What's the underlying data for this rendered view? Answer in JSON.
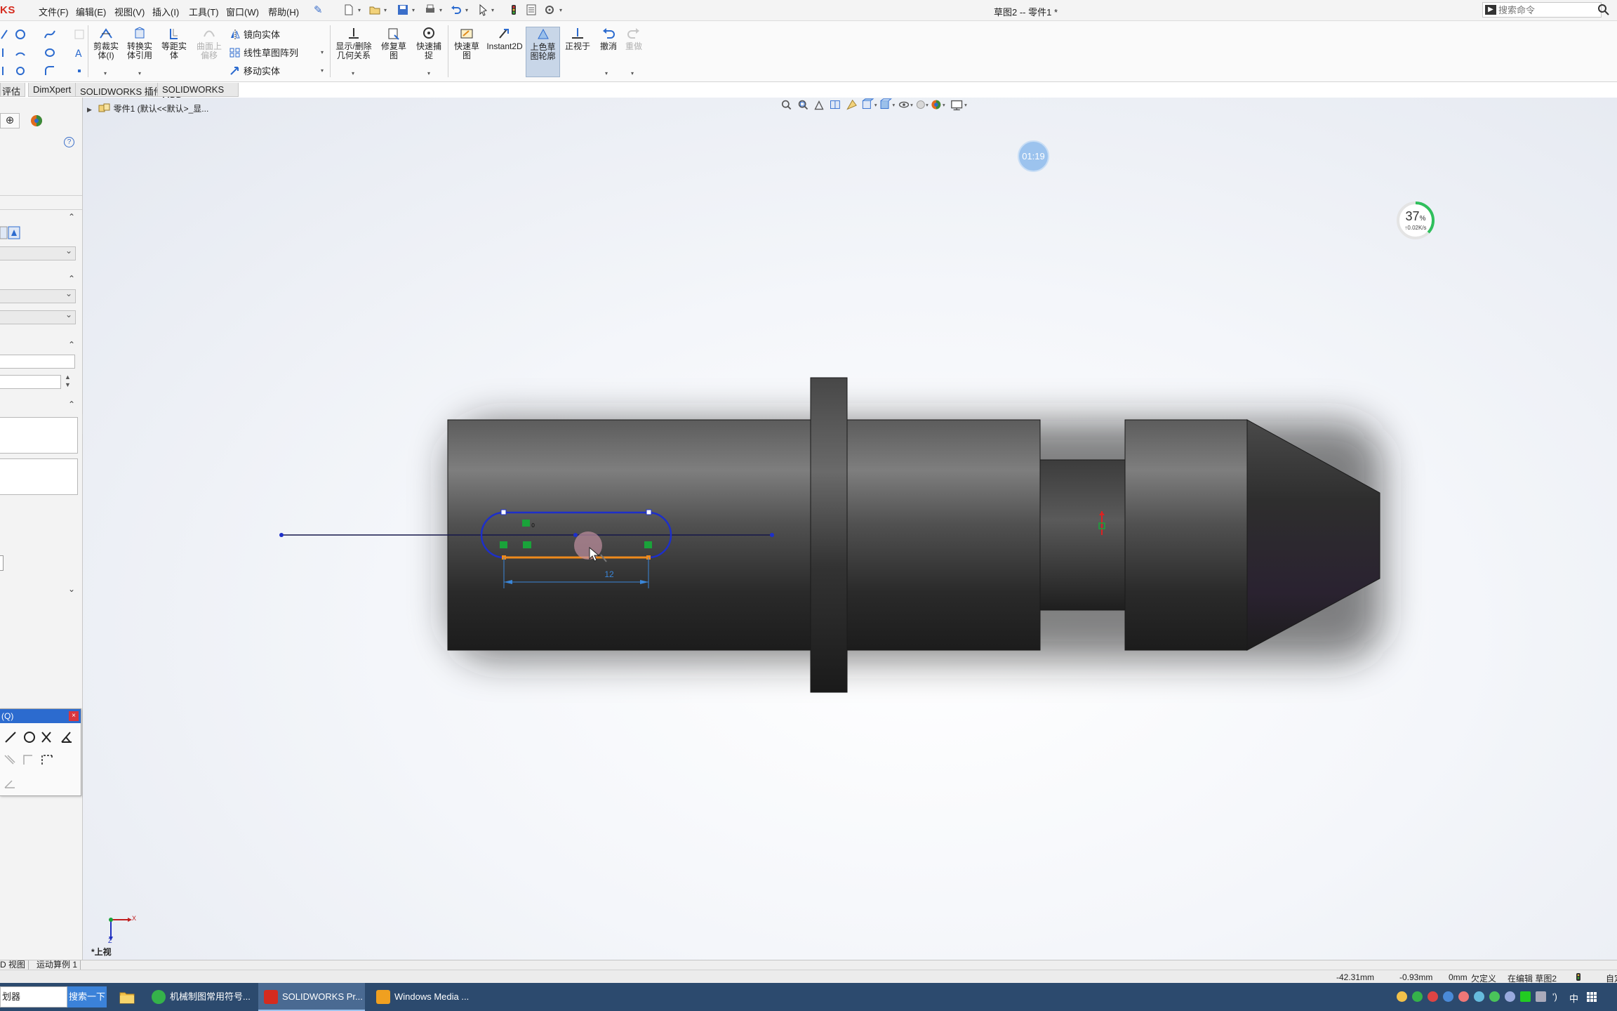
{
  "app": {
    "logo_text": "KS",
    "window_title": "草图2 -- 零件1 *"
  },
  "menu": {
    "items": [
      "文件(F)",
      "编辑(E)",
      "视图(V)",
      "插入(I)",
      "工具(T)",
      "窗口(W)",
      "帮助(H)"
    ]
  },
  "search": {
    "placeholder": "搜索命令"
  },
  "ribbon": {
    "trim": "剪裁实\n体(I)",
    "convert": "转换实\n体引用",
    "offset": "等距实\n体",
    "surface_offset": "曲面上\n偏移",
    "mirror": "镜向实体",
    "linear_pattern": "线性草图阵列",
    "move": "移动实体",
    "relations": "显示/删除\n几何关系",
    "repair": "修复草\n图",
    "quick_snap": "快速捕\n捉",
    "rapid_sketch": "快速草\n图",
    "instant2d": "Instant2D",
    "shaded_contours": "上色草\n图轮廓",
    "normal_to": "正视于",
    "undo": "撤消",
    "redo": "重做"
  },
  "command_tabs": [
    "评估",
    "DimXpert",
    "SOLIDWORKS 插件",
    "SOLIDWORKS MBD"
  ],
  "feature_tree": {
    "root_label": "零件1  (默认<<默认>_显..."
  },
  "viewport": {
    "dimension_value": "12",
    "view_label": "*上视",
    "triad_x": "X",
    "triad_z": "Z",
    "timer": "01:19",
    "gauge_percent": "37",
    "gauge_unit": "%",
    "gauge_rate": "↑0.02K/s",
    "gauge_level": 0.37
  },
  "sketch_toolbar": {
    "title": "(Q)",
    "close": "×"
  },
  "bottom_tabs": [
    "D 视图",
    "运动算例 1"
  ],
  "status_bar": {
    "x": "-42.31mm",
    "y": "-0.93mm",
    "z": "0mm",
    "state": "欠定义",
    "editing": "在编辑 草图2",
    "unit": "自定"
  },
  "taskbar": {
    "search_text": "划器",
    "search_button": "搜索一下",
    "apps": [
      {
        "label": "机械制图常用符号..."
      },
      {
        "label": "SOLIDWORKS Pr..."
      },
      {
        "label": "Windows Media ..."
      }
    ],
    "tray": {
      "volume": "')",
      "ime": "中"
    }
  },
  "colors": {
    "accent_blue": "#2c6bcf",
    "sketch_blue": "#1d2fc9",
    "dimension_blue": "#3a86d9",
    "selection_orange": "#ef8a1c",
    "relation_green": "#1aa33a",
    "taskbar": "#2c4a6e"
  }
}
